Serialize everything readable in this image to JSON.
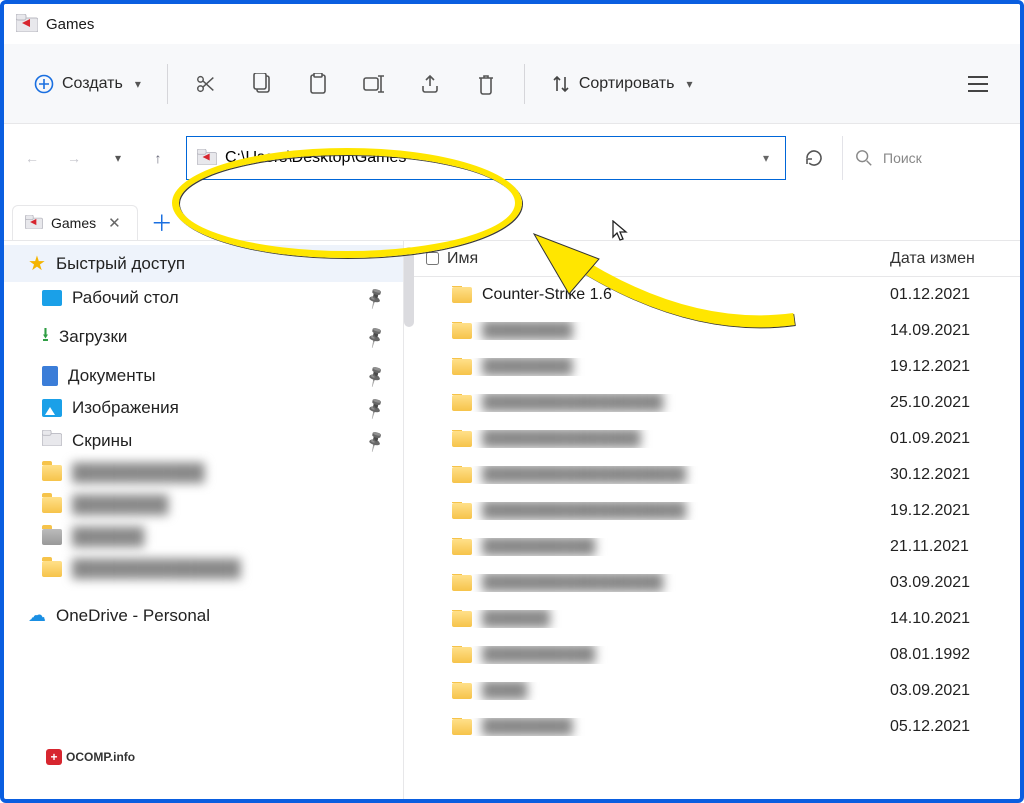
{
  "window": {
    "title": "Games"
  },
  "toolbar": {
    "create_label": "Создать",
    "sort_label": "Сортировать"
  },
  "address": {
    "path": "C:\\Users\\Desktop\\Games"
  },
  "search": {
    "placeholder": "Поиск"
  },
  "tabs": {
    "active": {
      "label": "Games"
    }
  },
  "sidebar": {
    "quick_access": "Быстрый доступ",
    "items": [
      {
        "label": "Рабочий стол",
        "icon": "desktop",
        "pinned": true
      },
      {
        "label": "Загрузки",
        "icon": "downloads",
        "pinned": true
      },
      {
        "label": "Документы",
        "icon": "documents",
        "pinned": true
      },
      {
        "label": "Изображения",
        "icon": "pictures",
        "pinned": true
      },
      {
        "label": "Скрины",
        "icon": "folder-img",
        "pinned": true
      }
    ],
    "onedrive_label": "OneDrive - Personal"
  },
  "columns": {
    "name": "Имя",
    "date": "Дата измен"
  },
  "files": [
    {
      "name": "Counter-Strike 1.6",
      "date": "01.12.2021",
      "blurred": false
    },
    {
      "name": "████████",
      "date": "14.09.2021",
      "blurred": true
    },
    {
      "name": "████████",
      "date": "19.12.2021",
      "blurred": true
    },
    {
      "name": "████████████████",
      "date": "25.10.2021",
      "blurred": true
    },
    {
      "name": "██████████████",
      "date": "01.09.2021",
      "blurred": true
    },
    {
      "name": "██████████████████",
      "date": "30.12.2021",
      "blurred": true
    },
    {
      "name": "██████████████████",
      "date": "19.12.2021",
      "blurred": true
    },
    {
      "name": "██████████",
      "date": "21.11.2021",
      "blurred": true
    },
    {
      "name": "████████████████",
      "date": "03.09.2021",
      "blurred": true
    },
    {
      "name": "██████",
      "date": "14.10.2021",
      "blurred": true
    },
    {
      "name": "██████████",
      "date": "08.01.1992",
      "blurred": true
    },
    {
      "name": "████",
      "date": "03.09.2021",
      "blurred": true
    },
    {
      "name": "████████",
      "date": "05.12.2021",
      "blurred": true
    }
  ],
  "watermark": {
    "text": "OCOMP.info"
  }
}
